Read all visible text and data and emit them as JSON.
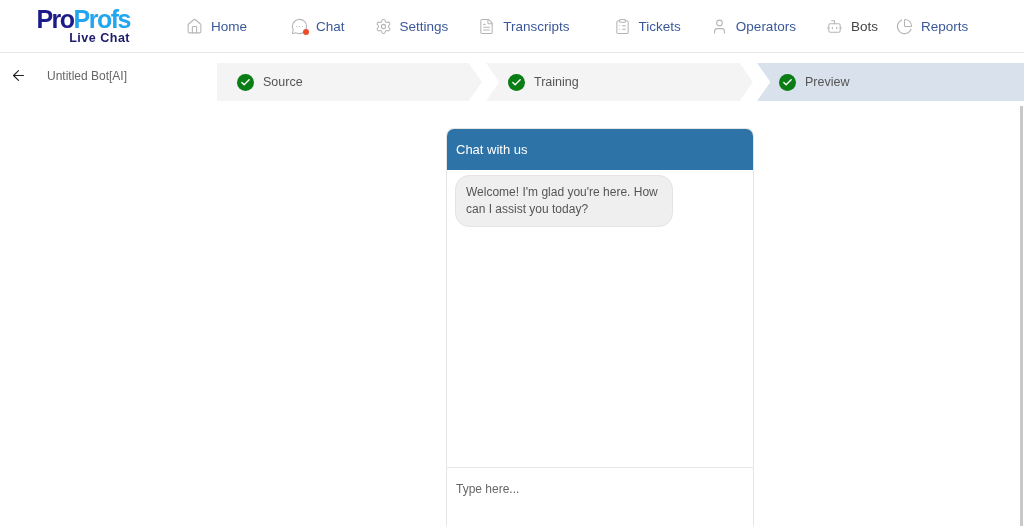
{
  "logo": {
    "brand_first": "Pro",
    "brand_second": "Profs",
    "product": "Live Chat"
  },
  "nav": [
    {
      "label": "Home",
      "selected": false,
      "alert": false
    },
    {
      "label": "Chat",
      "selected": false,
      "alert": true
    },
    {
      "label": "Settings",
      "selected": false,
      "alert": false
    },
    {
      "label": "Transcripts",
      "selected": false,
      "alert": false
    },
    {
      "label": "Tickets",
      "selected": false,
      "alert": false
    },
    {
      "label": "Operators",
      "selected": false,
      "alert": false
    },
    {
      "label": "Bots",
      "selected": true,
      "alert": false
    },
    {
      "label": "Reports",
      "selected": false,
      "alert": false
    }
  ],
  "bot_title": "Untitled Bot[AI]",
  "steps": [
    {
      "label": "Source",
      "done": true,
      "selected": false
    },
    {
      "label": "Training",
      "done": true,
      "selected": false
    },
    {
      "label": "Preview",
      "done": true,
      "selected": true
    }
  ],
  "chat": {
    "title": "Chat with us",
    "messages": [
      "Welcome! I'm glad you're here. How can I assist you today?"
    ],
    "input": {
      "placeholder": "Type here..."
    }
  }
}
